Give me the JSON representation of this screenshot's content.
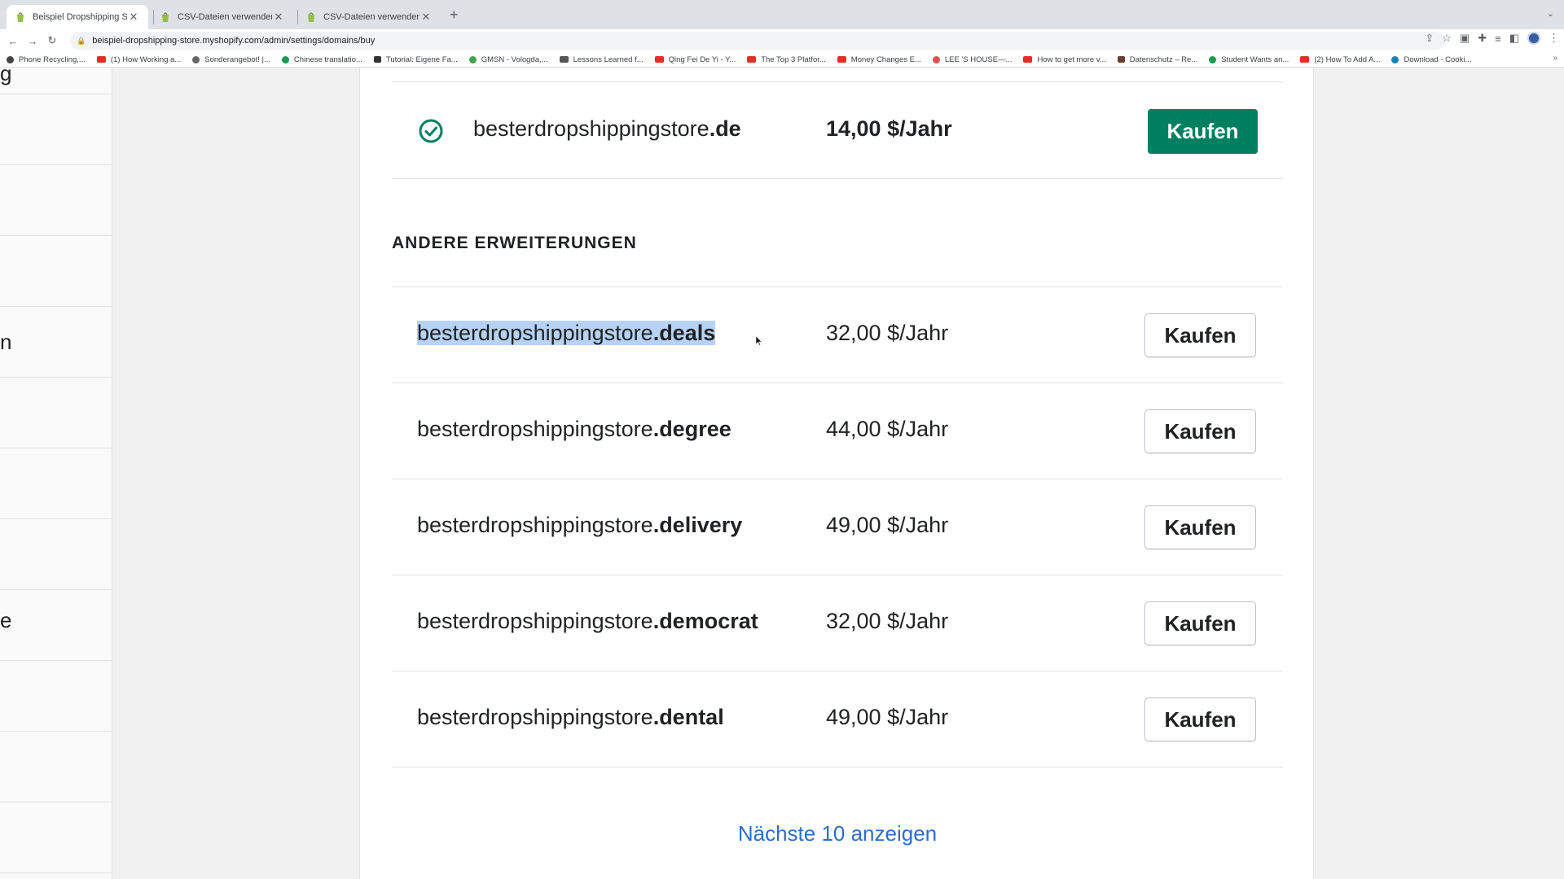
{
  "browser": {
    "tabs": [
      {
        "title": "Beispiel Dropshipping Store · D",
        "active": true
      },
      {
        "title": "CSV-Dateien verwenden, um P",
        "active": false
      },
      {
        "title": "CSV-Dateien verwenden, um P",
        "active": false
      }
    ],
    "url": "beispiel-dropshipping-store.myshopify.com/admin/settings/domains/buy",
    "bookmarks": [
      {
        "label": "Phone Recycling,..."
      },
      {
        "label": "(1) How Working a..."
      },
      {
        "label": "Sonderangebot! |..."
      },
      {
        "label": "Chinese translatio..."
      },
      {
        "label": "Tutorial: Eigene Fa..."
      },
      {
        "label": "GMSN - Vologda,..."
      },
      {
        "label": "Lessons Learned f..."
      },
      {
        "label": "Qing Fei De Yi - Y..."
      },
      {
        "label": "The Top 3 Platfor..."
      },
      {
        "label": "Money Changes E..."
      },
      {
        "label": "LEE 'S HOUSE—..."
      },
      {
        "label": "How to get more v..."
      },
      {
        "label": "Datenschutz – Re..."
      },
      {
        "label": "Student Wants an..."
      },
      {
        "label": "(2) How To Add A..."
      },
      {
        "label": "Download - Cooki..."
      }
    ]
  },
  "sidebar": {
    "fragments": [
      "g",
      "n",
      "e"
    ]
  },
  "featured": {
    "name": "besterdropshippingstore",
    "ext": ".de",
    "price": "14,00 $/Jahr",
    "button": "Kaufen"
  },
  "section_title": "ANDERE ERWEITERUNGEN",
  "domains": [
    {
      "name": "besterdropshippingstore",
      "ext": ".deals",
      "price": "32,00 $/Jahr",
      "button": "Kaufen"
    },
    {
      "name": "besterdropshippingstore",
      "ext": ".degree",
      "price": "44,00 $/Jahr",
      "button": "Kaufen"
    },
    {
      "name": "besterdropshippingstore",
      "ext": ".delivery",
      "price": "49,00 $/Jahr",
      "button": "Kaufen"
    },
    {
      "name": "besterdropshippingstore",
      "ext": ".democrat",
      "price": "32,00 $/Jahr",
      "button": "Kaufen"
    },
    {
      "name": "besterdropshippingstore",
      "ext": ".dental",
      "price": "49,00 $/Jahr",
      "button": "Kaufen"
    }
  ],
  "more_link": "Nächste 10 anzeigen",
  "colors": {
    "primary": "#008060",
    "link": "#2c6ecb",
    "selection": "#b6d2f5"
  }
}
